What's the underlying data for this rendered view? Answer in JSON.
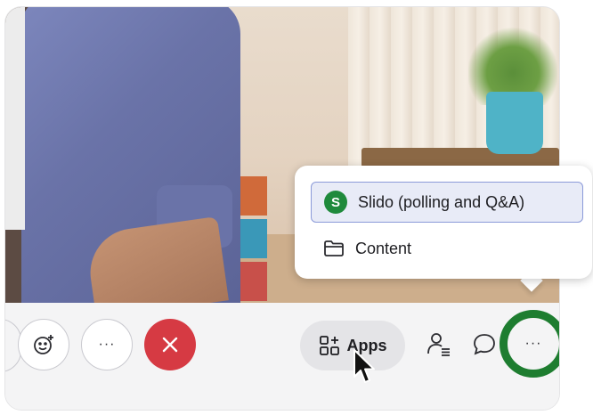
{
  "menu": {
    "items": [
      {
        "label": "Slido (polling and Q&A)",
        "icon": "slido-icon",
        "badge": "S",
        "selected": true
      },
      {
        "label": "Content",
        "icon": "folder-icon",
        "selected": false
      }
    ]
  },
  "toolbar": {
    "more_round_label": "···",
    "apps_label": "Apps",
    "more_highlight_label": "···"
  },
  "colors": {
    "leave": "#d63a43",
    "highlight_ring": "#1e7d30",
    "slido": "#1f8a3c",
    "selection_border": "#8b9ad9"
  }
}
